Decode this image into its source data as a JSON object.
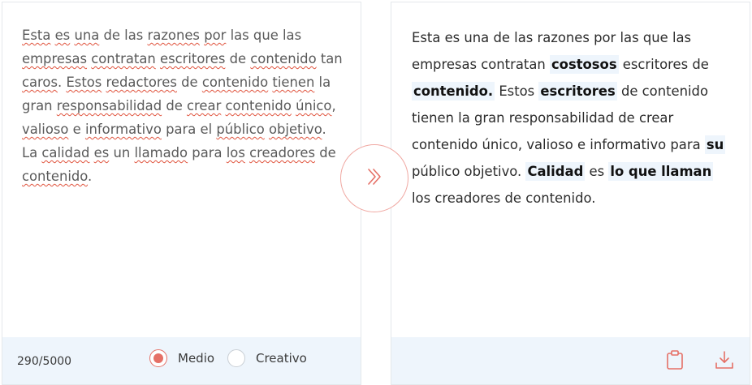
{
  "input": {
    "segments": [
      {
        "t": "Esta",
        "s": true
      },
      {
        "t": " "
      },
      {
        "t": "es",
        "s": true
      },
      {
        "t": " "
      },
      {
        "t": "una",
        "s": true
      },
      {
        "t": " de las "
      },
      {
        "t": "razones",
        "s": true
      },
      {
        "t": " "
      },
      {
        "t": "por",
        "s": true
      },
      {
        "t": " las que las "
      },
      {
        "t": "empresas",
        "s": true
      },
      {
        "t": " "
      },
      {
        "t": "contratan",
        "s": true
      },
      {
        "t": " "
      },
      {
        "t": "escritores",
        "s": true
      },
      {
        "t": " de "
      },
      {
        "t": "contenido",
        "s": true
      },
      {
        "t": " tan "
      },
      {
        "t": "caros",
        "s": true
      },
      {
        "t": ". "
      },
      {
        "t": "Estos",
        "s": true
      },
      {
        "t": " "
      },
      {
        "t": "redactores",
        "s": true
      },
      {
        "t": " de "
      },
      {
        "t": "contenido",
        "s": true
      },
      {
        "t": " "
      },
      {
        "t": "tienen",
        "s": true
      },
      {
        "t": " la gran "
      },
      {
        "t": "responsabilidad",
        "s": true
      },
      {
        "t": " de "
      },
      {
        "t": "crear",
        "s": true
      },
      {
        "t": " "
      },
      {
        "t": "contenido",
        "s": true
      },
      {
        "t": " "
      },
      {
        "t": "único",
        "s": true
      },
      {
        "t": ", "
      },
      {
        "t": "valioso",
        "s": true
      },
      {
        "t": " e "
      },
      {
        "t": "informativo",
        "s": true
      },
      {
        "t": " para el "
      },
      {
        "t": "público",
        "s": true
      },
      {
        "t": " "
      },
      {
        "t": "objetivo",
        "s": true
      },
      {
        "t": ". La "
      },
      {
        "t": "calidad",
        "s": true
      },
      {
        "t": " "
      },
      {
        "t": "es",
        "s": true
      },
      {
        "t": " un "
      },
      {
        "t": "llamado",
        "s": true
      },
      {
        "t": " para "
      },
      {
        "t": "los",
        "s": true
      },
      {
        "t": " "
      },
      {
        "t": "creadores",
        "s": true
      },
      {
        "t": " de "
      },
      {
        "t": "contenido",
        "s": true
      },
      {
        "t": "."
      }
    ],
    "char_count": "290/5000",
    "modes": [
      {
        "label": "Medio",
        "checked": true
      },
      {
        "label": "Creativo",
        "checked": false
      }
    ]
  },
  "output": {
    "segments": [
      {
        "t": "Esta es una de las razones por las que las empresas contratan "
      },
      {
        "t": "costosos",
        "h": true
      },
      {
        "t": " escritores de "
      },
      {
        "t": "contenido.",
        "h": true
      },
      {
        "t": " Estos "
      },
      {
        "t": "escritores",
        "h": true
      },
      {
        "t": " de contenido tienen la gran responsabilidad de crear contenido único, valioso e informativo para "
      },
      {
        "t": "su",
        "h": true
      },
      {
        "t": " público objetivo. "
      },
      {
        "t": "Calidad",
        "h": true
      },
      {
        "t": " es "
      },
      {
        "t": "lo que llaman",
        "h": true
      },
      {
        "t": " los creadores de contenido."
      }
    ]
  },
  "icons": {
    "convert": "double-chevron-right-icon",
    "copy": "clipboard-icon",
    "download": "download-icon"
  },
  "colors": {
    "accent": "#e57066",
    "footer_bg": "#eef5fc",
    "highlight_bg": "#eef5fc",
    "spell_underline": "#e0533d"
  }
}
